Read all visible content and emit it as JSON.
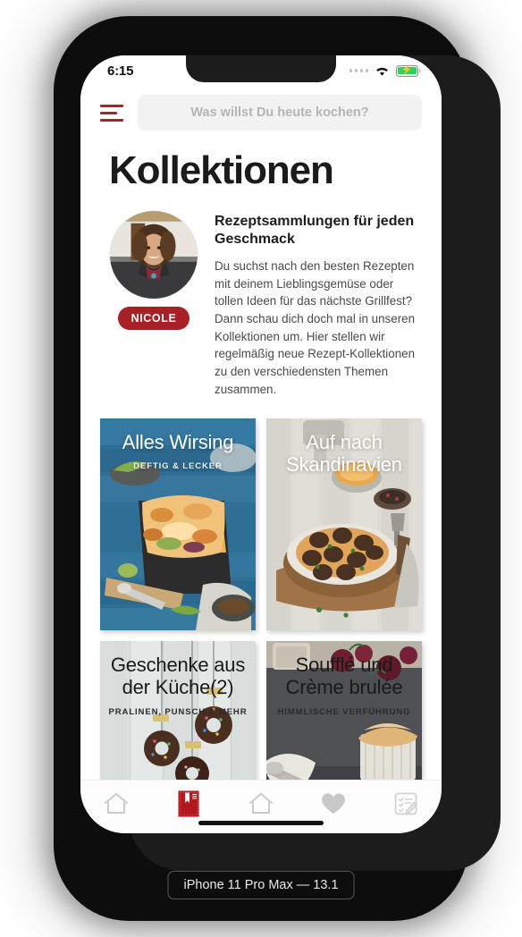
{
  "device": {
    "label": "iPhone 11 Pro Max — 13.1"
  },
  "status_bar": {
    "time": "6:15",
    "signal_icon": "signal-dots-icon",
    "wifi_icon": "wifi-icon",
    "battery_icon": "battery-charging-icon",
    "battery_color": "#30d158"
  },
  "header": {
    "menu_icon": "hamburger-menu-icon",
    "menu_color": "#b02028",
    "search": {
      "value": "",
      "placeholder": "Was willst Du heute kochen?"
    }
  },
  "main": {
    "title": "Kollektionen",
    "intro": {
      "author_name": "NICOLE",
      "badge_color": "#a81f26",
      "heading": "Rezeptsammlungen für jeden Geschmack",
      "body": "Du suchst nach den besten Rezepten mit deinem Lieblingsgemüse oder tollen Ideen für das nächste Grillfest?  Dann schau dich doch mal in unseren Kollektionen um. Hier stellen wir regelmäßig neue Rezept-Kollektionen zu den verschiedensten Themen zusammen."
    },
    "collections": [
      {
        "title": "Alles Wirsing",
        "subtitle": "DEFTIG & LECKER",
        "text_style": "light"
      },
      {
        "title": "Auf nach Skandinavien",
        "subtitle": "",
        "text_style": "light"
      },
      {
        "title": "Geschenke aus der Küche(2)",
        "subtitle": "PRALINEN, PUNSCH & MEHR",
        "text_style": "dark"
      },
      {
        "title": "Soufflé und Crème brulée",
        "subtitle": "HIMMLISCHE VERFÜHRUNG",
        "text_style": "dark"
      }
    ]
  },
  "tab_bar": {
    "tabs": [
      {
        "icon": "home-icon",
        "active": false
      },
      {
        "icon": "cookbook-icon",
        "active": true
      },
      {
        "icon": "home-icon",
        "active": false
      },
      {
        "icon": "heart-icon",
        "active": false
      },
      {
        "icon": "checklist-edit-icon",
        "active": false
      }
    ],
    "active_color": "#b3181f",
    "inactive_color": "#cccccc"
  }
}
